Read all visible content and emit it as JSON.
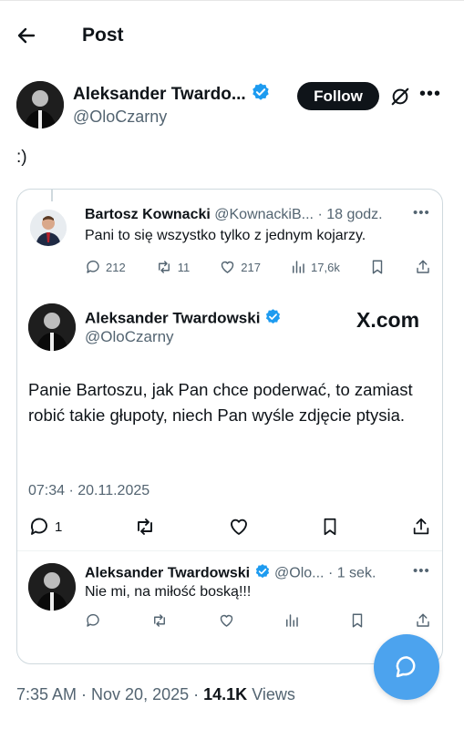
{
  "header": {
    "title": "Post",
    "back_icon": "arrow-left-icon"
  },
  "author": {
    "name": "Aleksander Twardo...",
    "handle": "@OloCzarny",
    "follow_label": "Follow",
    "verified_color": "#1d9bf0"
  },
  "tweet": {
    "text": ":)"
  },
  "quote": {
    "reply_parent": {
      "name": "Bartosz Kownacki",
      "meta": "@KownackiB... · 18 godz.",
      "text": "Pani to się wszystko tylko z jednym kojarzy.",
      "replies": "212",
      "reposts": "11",
      "likes": "217",
      "views": "17,6k"
    },
    "main": {
      "name": "Aleksander Twardowski",
      "handle": "@OloCzarny",
      "watermark": "X.com",
      "text": "Panie Bartoszu, jak Pan chce poderwać, to zamiast robić takie głupoty, niech Pan wyśle zdjęcie ptysia.",
      "time": "07:34 · 20.11.2025",
      "replies": "1"
    },
    "reply": {
      "name": "Aleksander Twardowski",
      "meta": "@Olo... · 1 sek.",
      "text": "Nie mi, na miłość boską!!!"
    }
  },
  "footer": {
    "timestamp": "7:35 AM · Nov 20, 2025 ·",
    "views_count": "14.1K",
    "views_label": "Views"
  },
  "colors": {
    "accent": "#1d9bf0",
    "fab": "#4ca3ee",
    "muted": "#536471"
  }
}
